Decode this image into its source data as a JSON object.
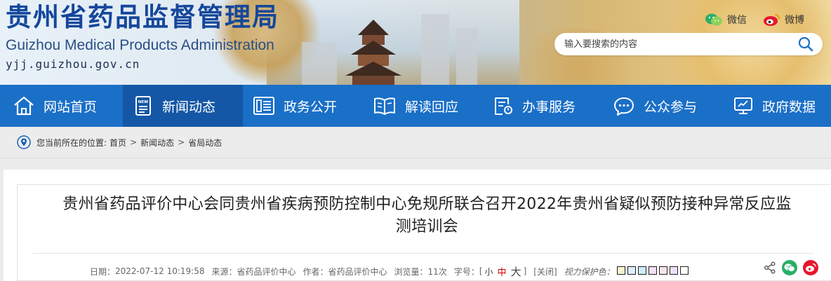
{
  "header": {
    "title_cn": "贵州省药品监督管理局",
    "title_en": "Guizhou Medical Products Administration",
    "url": "yjj.guizhou.gov.cn",
    "social": {
      "wechat": "微信",
      "weibo": "微博"
    },
    "search": {
      "placeholder": "输入要搜索的内容"
    }
  },
  "nav": {
    "items": [
      {
        "label": "网站首页",
        "icon": "home-icon"
      },
      {
        "label": "新闻动态",
        "icon": "news-icon",
        "active": true
      },
      {
        "label": "政务公开",
        "icon": "document-list-icon"
      },
      {
        "label": "解读回应",
        "icon": "open-book-icon"
      },
      {
        "label": "办事服务",
        "icon": "service-form-icon"
      },
      {
        "label": "公众参与",
        "icon": "chat-bubble-icon"
      },
      {
        "label": "政府数据",
        "icon": "monitor-chart-icon"
      }
    ]
  },
  "breadcrumb": {
    "prefix": "您当前所在的位置:",
    "items": [
      "首页",
      "新闻动态",
      "省局动态"
    ],
    "separator": ">"
  },
  "article": {
    "title_line1": "贵州省药品评价中心会同贵州省疾病预防控制中心免规所联合召开2022年贵州省疑似预防接种异常反应监",
    "title_line2": "测培训会",
    "meta": {
      "date_label": "日期：",
      "date": "2022-07-12 10:19:58",
      "source_label": "来源：",
      "source": "省药品评价中心",
      "author_label": "作者：",
      "author": "省药品评价中心",
      "views_label": "浏览量：",
      "views": "11次",
      "fontsize_label": "字号：",
      "font_open": "[",
      "font_small": "小",
      "font_medium": "中",
      "font_large": "大",
      "font_close": "]",
      "close_link": "[关闭]",
      "eye_care_label": "视力保护色："
    },
    "eye_care_colors": [
      "#fbf5d0",
      "#dceefc",
      "#cdeefb",
      "#f1e2f3",
      "#f5e5ea",
      "#efe1fa",
      "#ffffff"
    ]
  },
  "colors": {
    "nav_bg": "#1a6fc7",
    "nav_active": "#1457a6",
    "title_blue": "#15479b",
    "wechat_green": "#2aae67",
    "weibo_red": "#e6162d"
  }
}
